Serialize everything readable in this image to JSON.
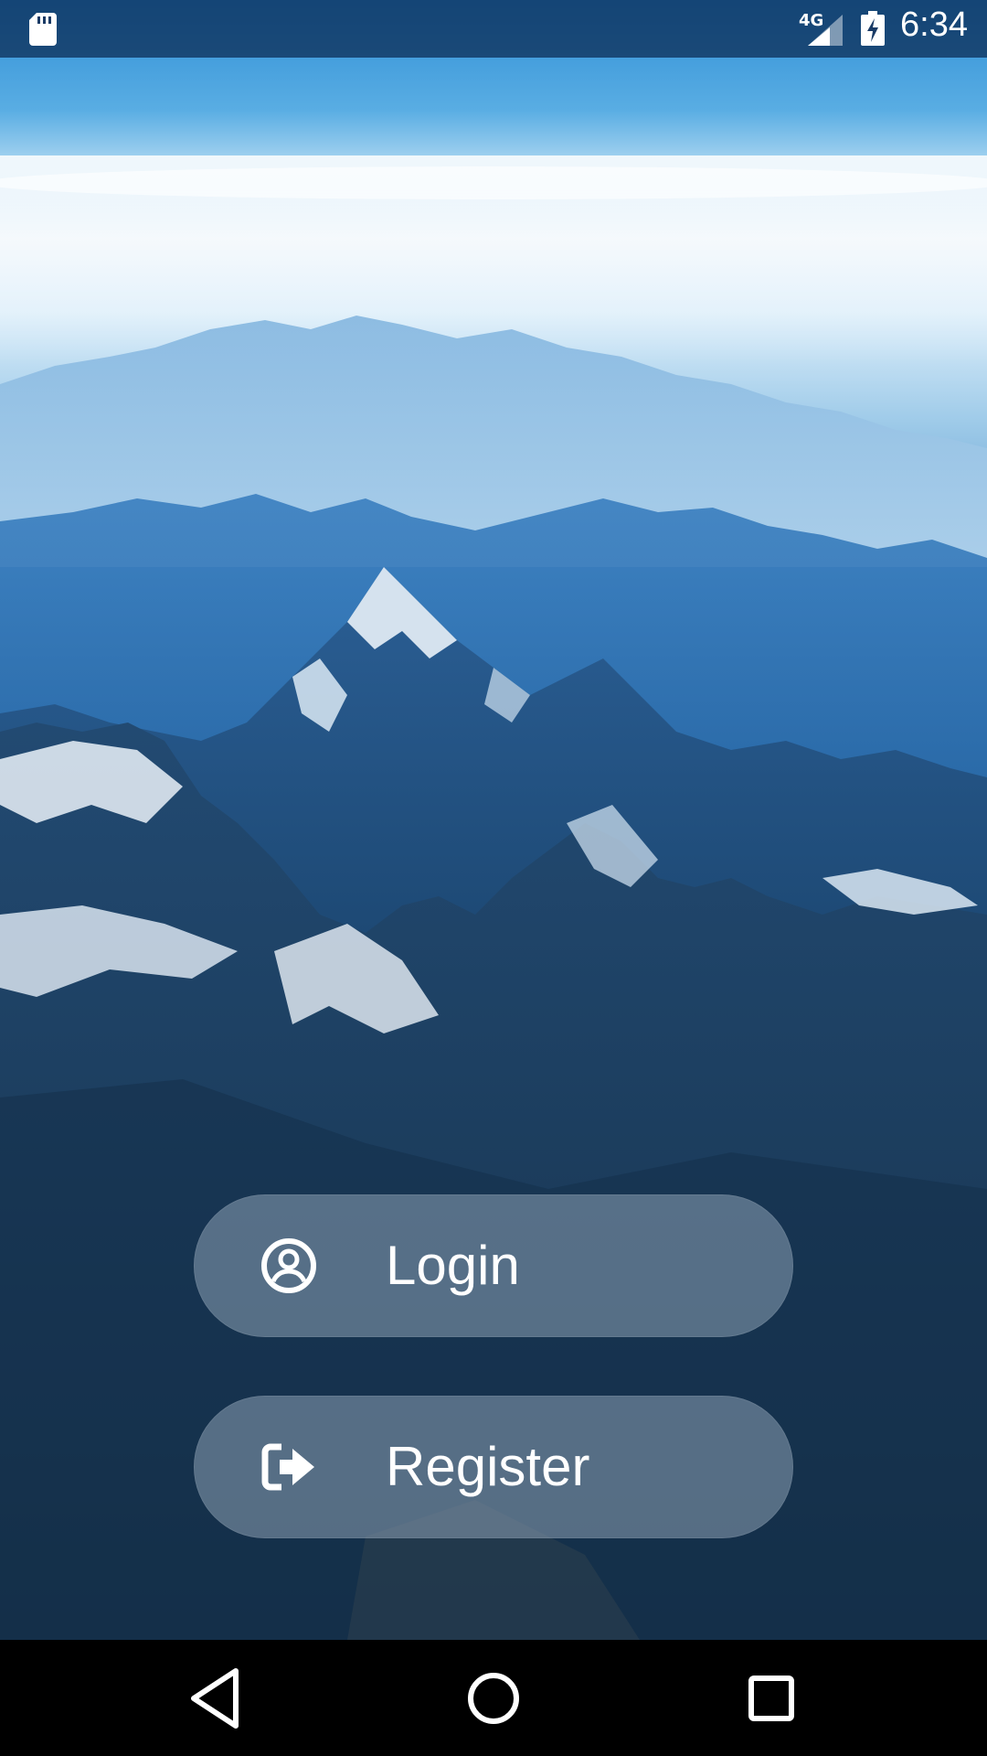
{
  "status_bar": {
    "network_type": "4G",
    "time": "6:34",
    "icons": [
      "sd-card-icon",
      "signal-icon",
      "battery-charging-icon"
    ]
  },
  "buttons": {
    "login": {
      "label": "Login",
      "icon": "account-circle-icon"
    },
    "register": {
      "label": "Register",
      "icon": "sign-in-arrow-icon"
    }
  },
  "nav_bar": {
    "icons": [
      "back-icon",
      "home-icon",
      "recents-icon"
    ]
  },
  "colors": {
    "sky": "#2f8fd6",
    "mountain_dark": "#1a4f86",
    "button_fill": "#8ca0b4",
    "text": "#ffffff"
  }
}
